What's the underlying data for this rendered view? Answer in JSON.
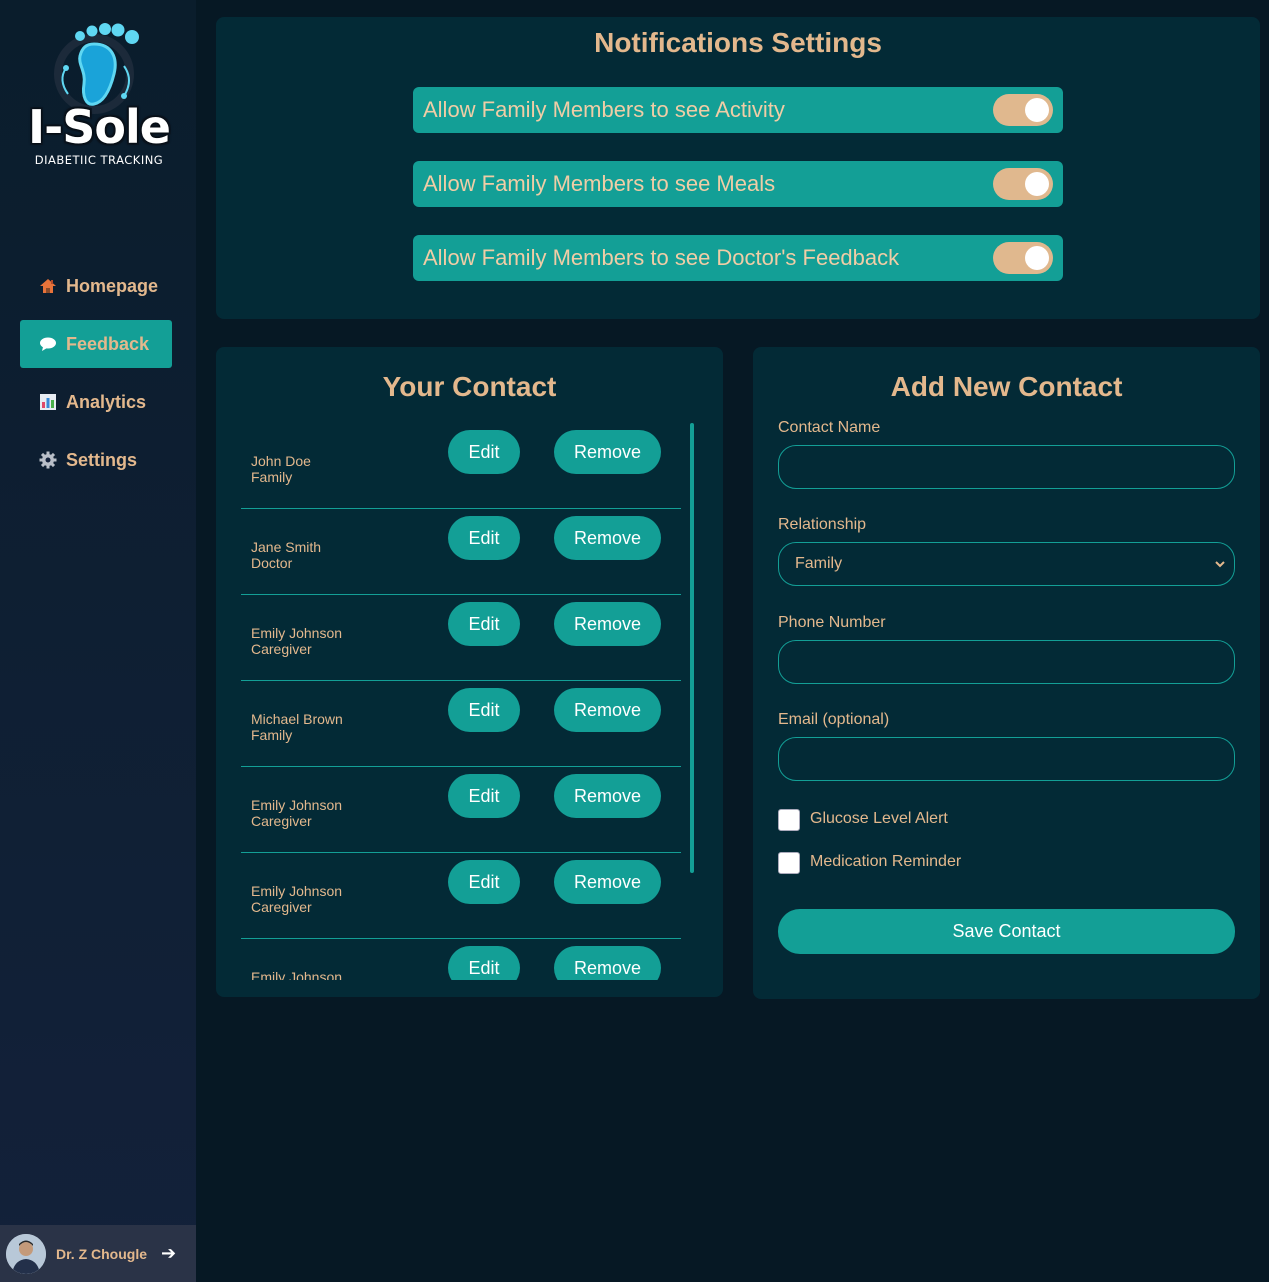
{
  "sidebar": {
    "brand": "I-Sole",
    "tagline": "DIABETIIC TRACKING",
    "items": [
      {
        "label": "Homepage",
        "icon": "house-icon"
      },
      {
        "label": "Feedback",
        "icon": "speech-bubble-icon",
        "active": true
      },
      {
        "label": "Analytics",
        "icon": "bar-chart-icon"
      },
      {
        "label": "Settings",
        "icon": "gear-icon"
      }
    ],
    "user": {
      "name": "Dr. Z Chougle",
      "logout_icon": "arrow-right-icon"
    }
  },
  "notifications": {
    "title": "Notifications Settings",
    "toggles": [
      {
        "label": "Allow Family Members to see Activity",
        "on": true
      },
      {
        "label": "Allow Family Members to see Meals",
        "on": true
      },
      {
        "label": "Allow Family Members to see Doctor's Feedback",
        "on": true
      }
    ]
  },
  "contacts": {
    "title": "Your Contact",
    "edit_label": "Edit",
    "remove_label": "Remove",
    "rows": [
      {
        "name": "John Doe",
        "relation": "Family"
      },
      {
        "name": "Jane Smith",
        "relation": "Doctor"
      },
      {
        "name": "Emily Johnson",
        "relation": "Caregiver"
      },
      {
        "name": "Michael Brown",
        "relation": "Family"
      },
      {
        "name": "Emily Johnson",
        "relation": "Caregiver"
      },
      {
        "name": "Emily Johnson",
        "relation": "Caregiver"
      },
      {
        "name": "Emily Johnson",
        "relation": ""
      }
    ]
  },
  "add_contact": {
    "title": "Add New Contact",
    "name_label": "Contact Name",
    "name_value": "",
    "relationship_label": "Relationship",
    "relationship_value": "Family",
    "phone_label": "Phone Number",
    "phone_value": "",
    "email_label": "Email (optional)",
    "email_value": "",
    "glucose_label": "Glucose Level Alert",
    "glucose_checked": false,
    "medication_label": "Medication Reminder",
    "medication_checked": false,
    "save_label": "Save Contact"
  },
  "colors": {
    "accent": "#139f96",
    "text": "#e3b88d",
    "panel": "#032a36",
    "background": "#061824"
  }
}
